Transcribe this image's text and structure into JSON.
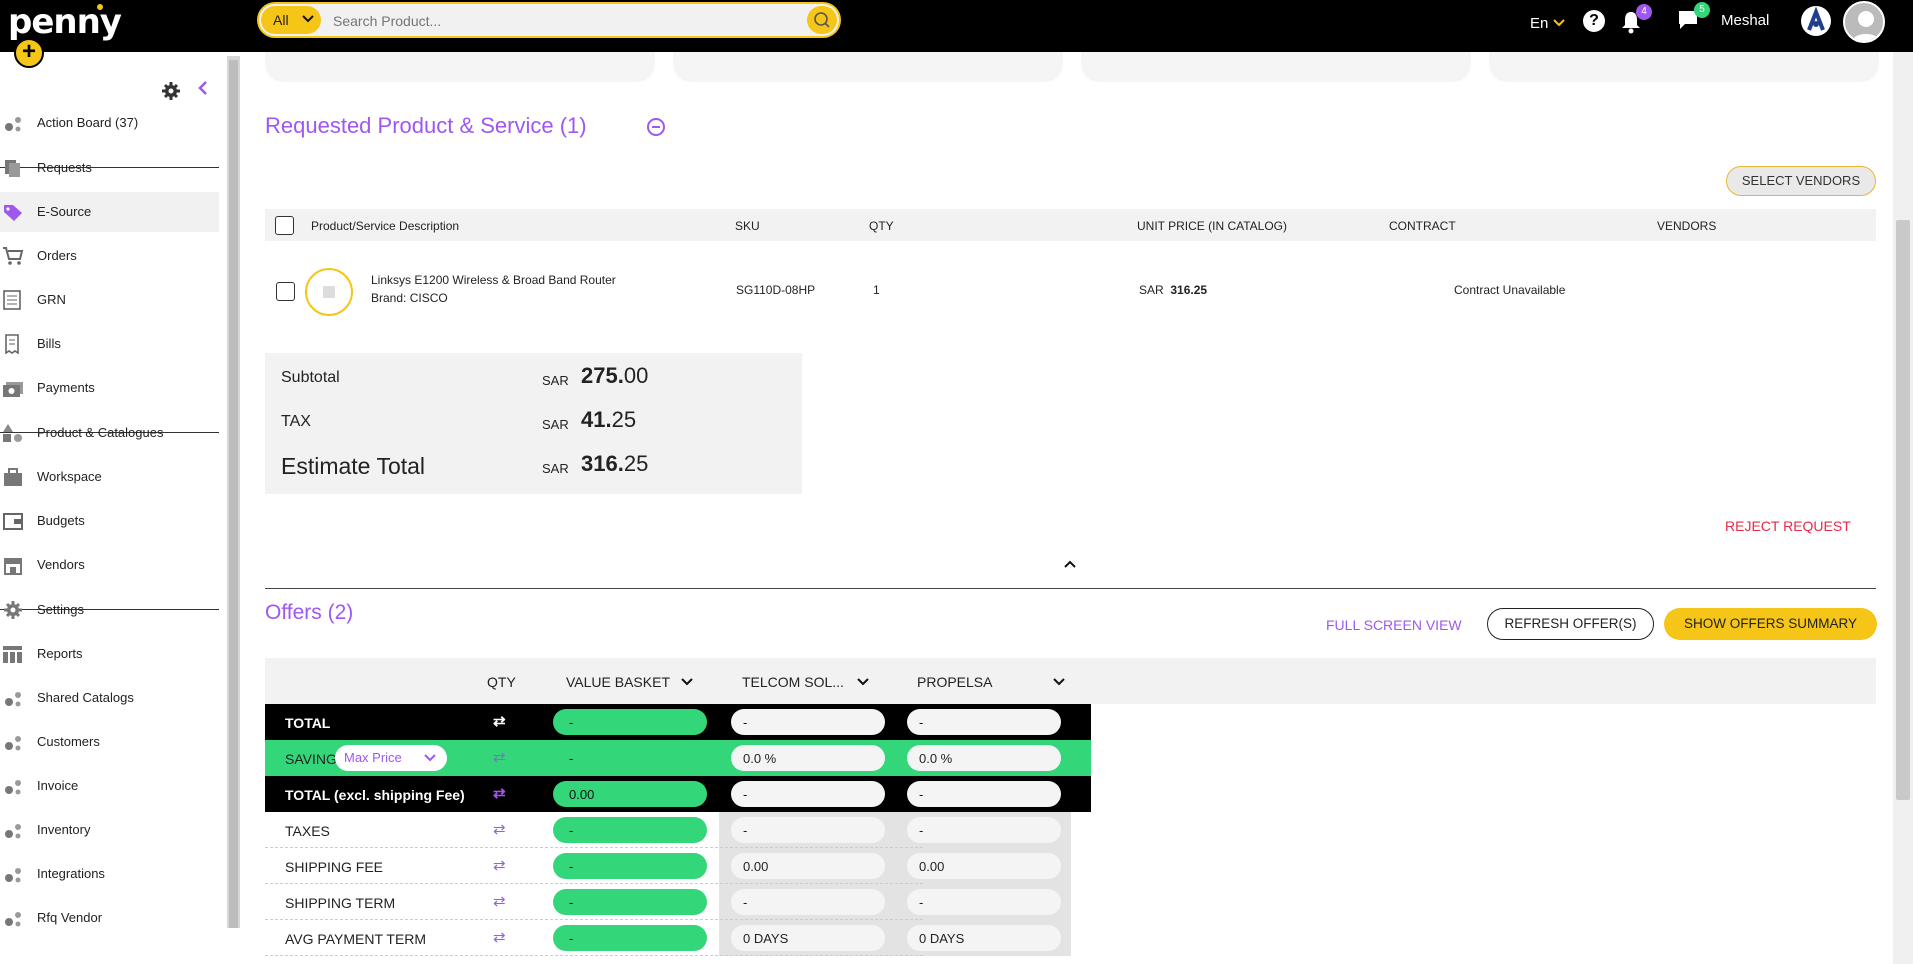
{
  "header": {
    "logo": "penny",
    "search": {
      "scope": "All",
      "placeholder": "Search Product..."
    },
    "language": "En",
    "notifications_count": "4",
    "messages_count": "5",
    "user_name": "Meshal",
    "colors": {
      "accent": "#f5c518",
      "notif_badge": "#a057f0",
      "msg_badge": "#34d67a"
    }
  },
  "sidebar": {
    "items": [
      {
        "label": "Action Board (37)",
        "icon": "dots-icon"
      },
      {
        "label": "Requests",
        "icon": "documents-icon"
      },
      {
        "label": "E-Source",
        "icon": "tag-icon",
        "active": true
      },
      {
        "label": "Orders",
        "icon": "cart-icon"
      },
      {
        "label": "GRN",
        "icon": "list-icon"
      },
      {
        "label": "Bills",
        "icon": "receipt-icon"
      },
      {
        "label": "Payments",
        "icon": "money-icon"
      },
      {
        "label": "Product & Catalogues",
        "icon": "shapes-icon"
      },
      {
        "label": "Workspace",
        "icon": "briefcase-icon"
      },
      {
        "label": "Budgets",
        "icon": "wallet-icon"
      },
      {
        "label": "Vendors",
        "icon": "store-icon"
      },
      {
        "label": "Settings",
        "icon": "gear-icon"
      },
      {
        "label": "Reports",
        "icon": "grid-icon"
      },
      {
        "label": "Shared Catalogs",
        "icon": "dots-icon"
      },
      {
        "label": "Customers",
        "icon": "dots-icon"
      },
      {
        "label": "Invoice",
        "icon": "dots-icon"
      },
      {
        "label": "Inventory",
        "icon": "dots-icon"
      },
      {
        "label": "Integrations",
        "icon": "dots-icon"
      },
      {
        "label": "Rfq Vendor",
        "icon": "dots-icon"
      }
    ]
  },
  "requested": {
    "title": "Requested Product & Service (1)",
    "select_vendors": "SELECT VENDORS",
    "columns": {
      "description": "Product/Service Description",
      "sku": "SKU",
      "qty": "QTY",
      "unit_price": "UNIT PRICE (IN CATALOG)",
      "contract": "CONTRACT",
      "vendors": "VENDORS"
    },
    "row": {
      "name": "Linksys E1200 Wireless & Broad Band Router",
      "brand_label": "Brand:",
      "brand": "CISCO",
      "sku": "SG110D-08HP",
      "qty": "1",
      "currency": "SAR",
      "price": "316.25",
      "contract": "Contract Unavailable"
    },
    "summary": {
      "subtotal_label": "Subtotal",
      "subtotal_cur": "SAR",
      "subtotal_int": "275.",
      "subtotal_dec": "00",
      "tax_label": "TAX",
      "tax_cur": "SAR",
      "tax_int": "41.",
      "tax_dec": "25",
      "total_label": "Estimate Total",
      "total_cur": "SAR",
      "total_int": "316.",
      "total_dec": "25"
    },
    "reject": "REJECT REQUEST"
  },
  "offers": {
    "title": "Offers (2)",
    "full_screen": "FULL SCREEN VIEW",
    "refresh": "REFRESH OFFER(S)",
    "show_summary": "SHOW OFFERS SUMMARY",
    "headers": {
      "qty": "QTY",
      "basket": "VALUE BASKET",
      "vendor1": "TELCOM SOL...",
      "vendor2": "PROPELSA"
    },
    "savings_select": "Max Price",
    "rows": [
      {
        "label": "TOTAL",
        "basket": "-",
        "v1": "-",
        "v2": "-"
      },
      {
        "label": "SAVINGS",
        "basket": "-",
        "v1": "0.0 %",
        "v2": "0.0 %"
      },
      {
        "label": "TOTAL (excl. shipping Fee)",
        "basket": "0.00",
        "v1": "-",
        "v2": "-"
      },
      {
        "label": "TAXES",
        "basket": "-",
        "v1": "-",
        "v2": "-"
      },
      {
        "label": "SHIPPING FEE",
        "basket": "-",
        "v1": "0.00",
        "v2": "0.00"
      },
      {
        "label": "SHIPPING TERM",
        "basket": "-",
        "v1": "-",
        "v2": "-"
      },
      {
        "label": "AVG PAYMENT TERM",
        "basket": "-",
        "v1": "0 DAYS",
        "v2": "0 DAYS"
      }
    ]
  }
}
